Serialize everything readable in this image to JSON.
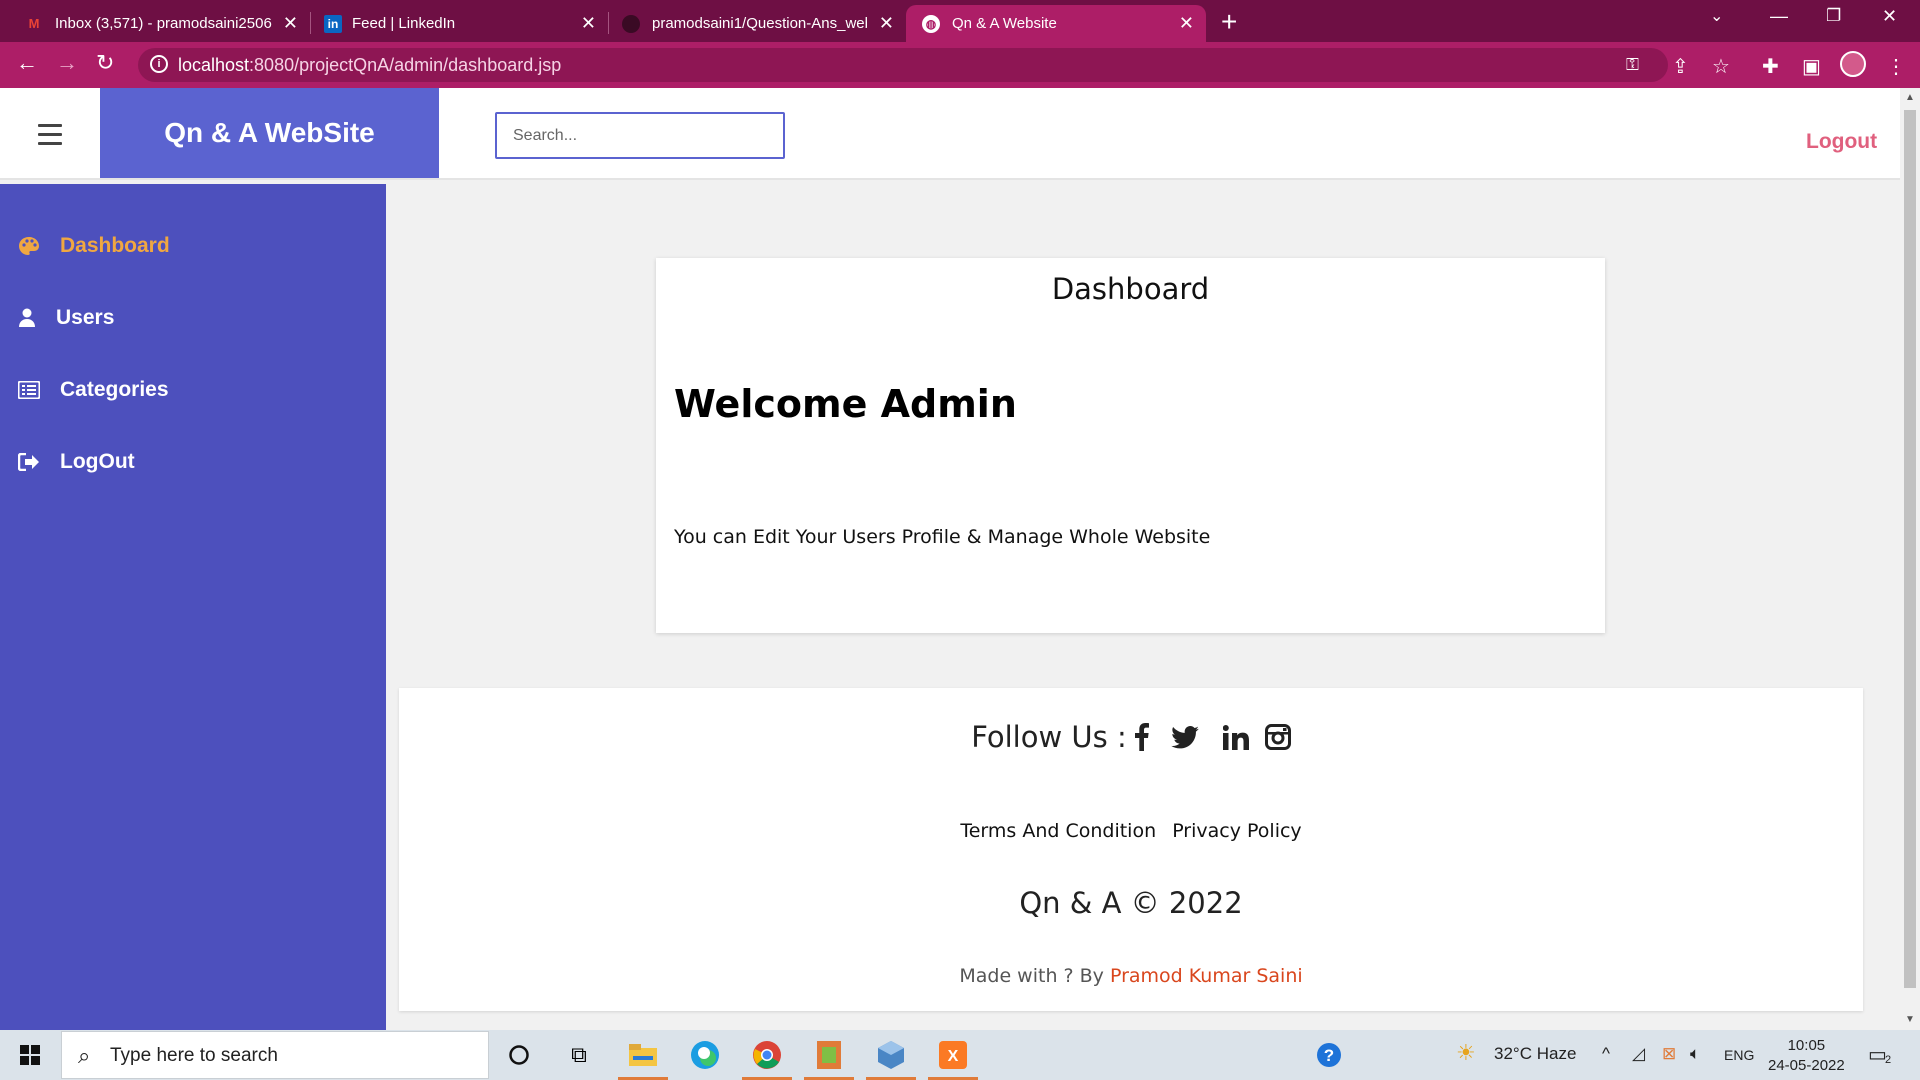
{
  "browser": {
    "tabs": [
      {
        "title": "Inbox (3,571) - pramodsaini2506",
        "favicon": "gmail-icon"
      },
      {
        "title": "Feed | LinkedIn",
        "favicon": "linkedin-icon"
      },
      {
        "title": "pramodsaini1/Question-Ans_web",
        "favicon": "github-icon"
      },
      {
        "title": "Qn & A Website",
        "favicon": "globe-icon"
      }
    ],
    "url_host": "localhost",
    "url_rest": ":8080/projectQnA/admin/dashboard.jsp"
  },
  "header": {
    "brand": "Qn & A WebSite",
    "search_placeholder": "Search...",
    "logout": "Logout"
  },
  "sidebar": {
    "items": [
      {
        "label": "Dashboard",
        "icon": "palette-icon",
        "active": true
      },
      {
        "label": "Users",
        "icon": "user-icon"
      },
      {
        "label": "Categories",
        "icon": "list-icon"
      },
      {
        "label": "LogOut",
        "icon": "sign-out-icon"
      }
    ]
  },
  "card": {
    "title": "Dashboard",
    "heading": "Welcome Admin",
    "text": "You can Edit Your Users Profile & Manage Whole Website"
  },
  "footer": {
    "follow_label": "Follow Us :",
    "socials": [
      "facebook-icon",
      "twitter-icon",
      "linkedin-icon",
      "instagram-icon"
    ],
    "links": [
      "Terms And Condition",
      "Privacy Policy"
    ],
    "copyright": "Qn & A © 2022",
    "made_prefix": "Made with ? By",
    "author": "Pramod Kumar Saini"
  },
  "taskbar": {
    "search_placeholder": "Type here to search",
    "weather": "32°C  Haze",
    "language": "ENG",
    "time": "10:05",
    "date": "24-05-2022",
    "notifications": "2"
  },
  "colors": {
    "chrome_dark": "#6e0f44",
    "chrome": "#ad1e67",
    "brand": "#5b63d0",
    "sidebar": "#4d50bd",
    "active": "#f0a741",
    "logout": "#e0607e",
    "author": "#d9461d"
  }
}
